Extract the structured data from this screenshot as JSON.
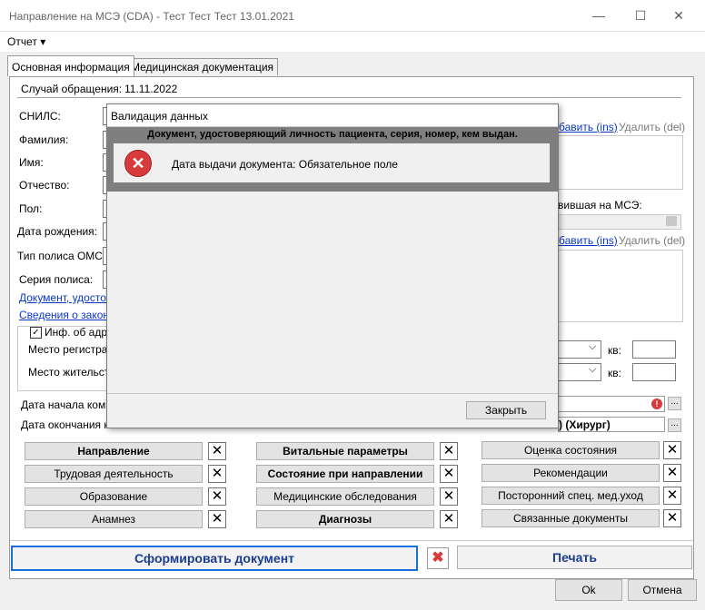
{
  "window": {
    "title": "Направление на МСЭ (CDA) - Тест Тест Тест 13.01.2021",
    "minimize": "—",
    "maximize": "☐",
    "close": "✕"
  },
  "menu": {
    "report": "Отчет ▾"
  },
  "tabs": {
    "main": "Основная информация",
    "medical": "Медицинская документация"
  },
  "form": {
    "case_label": "Случай обращения:",
    "case_date": "11.11.2022",
    "snils": "СНИЛС:",
    "surname": "Фамилия:",
    "name": "Имя:",
    "patronymic": "Отчество:",
    "sex": "Пол:",
    "birth_date": "Дата рождения:",
    "policy_type": "Тип полиса ОМС:",
    "policy_series": "Серия полиса:",
    "doc_link": "Документ, удостов",
    "law_link": "Сведения о законн",
    "address_check": "Инф. об адре",
    "reg_place": "Место регистрац",
    "live_place": "Место жительст",
    "apt": "кв:",
    "commission_start": "Дата начала коми",
    "commission_end": "Дата окончания ко",
    "right_add1": "бавить (ins)",
    "right_del1": "Удалить (del)",
    "right_mse": "вившая на МСЭ:",
    "right_add2": "бавить (ins)",
    "right_del2": "Удалить (del)",
    "surgeon": ") (Хирург)",
    "ellipsis": "..."
  },
  "sections": {
    "col1": [
      "Направление",
      "Трудовая деятельность",
      "Образование",
      "Анамнез"
    ],
    "col2": [
      "Витальные параметры",
      "Состояние при направлении",
      "Медицинские обследования",
      "Диагнозы"
    ],
    "col3": [
      "Оценка состояния",
      "Рекомендации",
      "Посторонний спец. мед.уход",
      "Связанные документы"
    ]
  },
  "actions": {
    "generate": "Сформировать документ",
    "print": "Печать",
    "ok": "Ok",
    "cancel": "Отмена"
  },
  "dialog": {
    "title": "Валидация данных",
    "header": "Документ, удостоверяющий личность пациента, серия, номер, кем выдан.",
    "message": "Дата выдачи документа: Обязательное поле",
    "close": "Закрыть"
  },
  "colors": {
    "accent": "#0a37c8",
    "error": "#d83b3b",
    "dialog_header": "#7f7f7f"
  }
}
